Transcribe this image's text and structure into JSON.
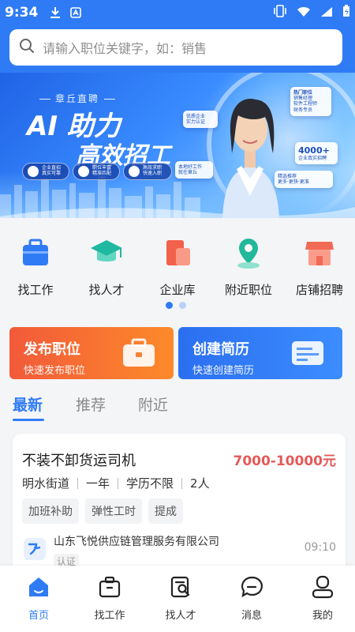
{
  "status_bar": {
    "time": "9:34"
  },
  "search": {
    "placeholder": "请输入职位关键字，如：销售"
  },
  "banner": {
    "brand": "章丘直聘",
    "headline_1": "AI 助力",
    "headline_2": "高效招工",
    "pills": [
      {
        "line1": "企业直招",
        "line2": "真实可靠"
      },
      {
        "line1": "职位丰富",
        "line2": "精准匹配"
      },
      {
        "line1": "高效求职",
        "line2": "快速入职"
      }
    ],
    "floating_cards": [
      {
        "line1": "热门职位",
        "line2": "销售经理",
        "line3": "软件工程师",
        "line4": "财务专员"
      },
      {
        "line1": "优质企业",
        "line2": "实力认证"
      },
      {
        "line1": "4000+",
        "line2": "企业真实招聘"
      },
      {
        "line1": "本地好工作",
        "line2": "就在章丘"
      },
      {
        "line1": "精选推荐",
        "line2": "更多·更快·更准"
      }
    ]
  },
  "categories": [
    {
      "label": "找工作",
      "color": "#2f7bf5"
    },
    {
      "label": "找人才",
      "color": "#1fb8a0"
    },
    {
      "label": "企业库",
      "color": "#f2614b"
    },
    {
      "label": "附近职位",
      "color": "#22b89a"
    },
    {
      "label": "店铺招聘",
      "color": "#f06a55"
    }
  ],
  "actions": [
    {
      "title": "发布职位",
      "subtitle": "快速发布职位"
    },
    {
      "title": "创建简历",
      "subtitle": "快速创建简历"
    }
  ],
  "tabs": [
    {
      "label": "最新",
      "active": true
    },
    {
      "label": "推荐",
      "active": false
    },
    {
      "label": "附近",
      "active": false
    }
  ],
  "job": {
    "title": "不装不卸货运司机",
    "salary": "7000-10000元",
    "location": "明水街道",
    "experience": "一年",
    "education": "学历不限",
    "headcount": "2人",
    "tags": [
      "加班补助",
      "弹性工时",
      "提成"
    ],
    "company": "山东飞悦供应链管理服务有限公司",
    "verified": "认证",
    "time": "09:10"
  },
  "nav": [
    {
      "label": "首页",
      "active": true
    },
    {
      "label": "找工作",
      "active": false
    },
    {
      "label": "找人才",
      "active": false
    },
    {
      "label": "消息",
      "active": false
    },
    {
      "label": "我的",
      "active": false
    }
  ],
  "colors": {
    "primary": "#2f7bf5",
    "salary": "#e45a5a",
    "orange": "#f25a3a"
  }
}
